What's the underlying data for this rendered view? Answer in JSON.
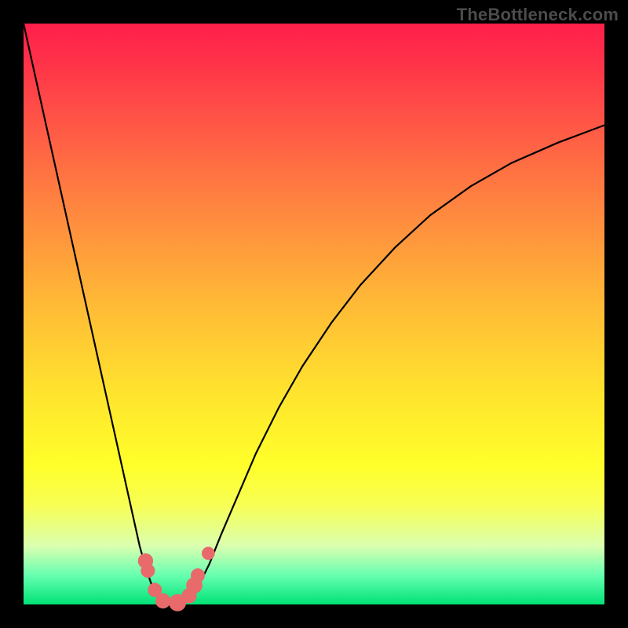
{
  "watermark": {
    "text": "TheBottleneck.com"
  },
  "colors": {
    "dot": "#e86a6a",
    "curve": "#000000",
    "frame_bg_top": "#ff1f4a",
    "frame_bg_bottom": "#00e277",
    "page_bg": "#000000"
  },
  "chart_data": {
    "type": "line",
    "title": "",
    "xlabel": "",
    "ylabel": "",
    "xlim": [
      0,
      100
    ],
    "ylim": [
      0,
      100
    ],
    "grid": false,
    "legend": false,
    "annotations": [
      "TheBottleneck.com"
    ],
    "series": [
      {
        "name": "left-branch",
        "x": [
          0.0,
          2.0,
          4.0,
          6.0,
          8.0,
          10.0,
          12.0,
          14.0,
          16.0,
          18.0,
          19.0,
          20.0,
          21.0,
          22.0,
          23.0,
          24.0
        ],
        "y": [
          100.0,
          91.0,
          82.0,
          73.0,
          64.0,
          55.0,
          46.0,
          37.0,
          28.0,
          19.0,
          14.5,
          10.0,
          6.5,
          3.5,
          1.5,
          0.5
        ]
      },
      {
        "name": "right-branch",
        "x": [
          28.0,
          30.0,
          32.0,
          34.0,
          37.0,
          40.0,
          44.0,
          48.0,
          53.0,
          58.0,
          64.0,
          70.0,
          77.0,
          84.0,
          92.0,
          100.0
        ],
        "y": [
          0.5,
          3.0,
          7.0,
          12.0,
          19.0,
          26.0,
          34.0,
          41.0,
          48.5,
          55.0,
          61.5,
          67.0,
          72.0,
          76.0,
          79.5,
          82.5
        ]
      },
      {
        "name": "floor",
        "x": [
          24.0,
          25.0,
          26.0,
          27.0,
          28.0
        ],
        "y": [
          0.5,
          0.0,
          0.0,
          0.0,
          0.5
        ]
      }
    ],
    "markers": [
      {
        "x": 21.0,
        "y": 7.5,
        "r": 1.0
      },
      {
        "x": 21.4,
        "y": 5.8,
        "r": 0.9
      },
      {
        "x": 22.6,
        "y": 2.5,
        "r": 0.9
      },
      {
        "x": 24.0,
        "y": 0.6,
        "r": 1.0
      },
      {
        "x": 26.5,
        "y": 0.3,
        "r": 1.2
      },
      {
        "x": 28.5,
        "y": 1.5,
        "r": 1.0
      },
      {
        "x": 29.4,
        "y": 3.3,
        "r": 1.1
      },
      {
        "x": 30.0,
        "y": 5.0,
        "r": 0.9
      },
      {
        "x": 31.8,
        "y": 8.8,
        "r": 0.8
      }
    ]
  }
}
